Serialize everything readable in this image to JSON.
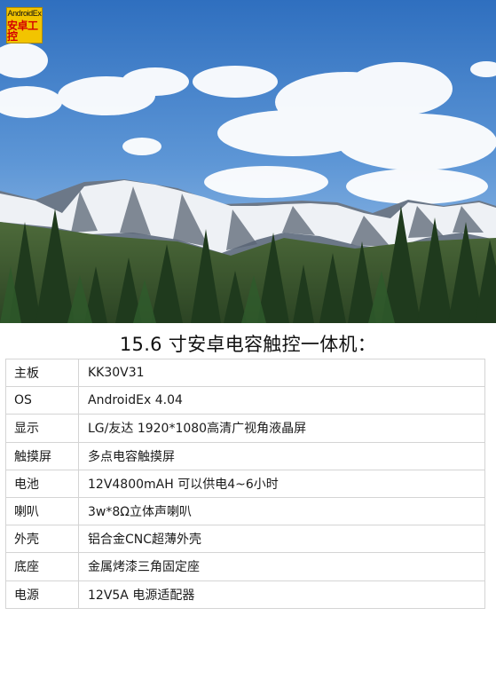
{
  "logo": {
    "line1": "AndroidEx",
    "line2": "安卓工控"
  },
  "title": "15.6 寸安卓电容触控一体机：",
  "specs": [
    {
      "label": "主板",
      "value": "KK30V31"
    },
    {
      "label": "OS",
      "value": "AndroidEx 4.04"
    },
    {
      "label": "显示",
      "value": "LG/友达 1920*1080高清广视角液晶屏"
    },
    {
      "label": "触摸屏",
      "value": "多点电容触摸屏"
    },
    {
      "label": "电池",
      "value": "12V4800mAH 可以供电4~6小时"
    },
    {
      "label": "喇叭",
      "value": "3w*8Ω立体声喇叭"
    },
    {
      "label": "外壳",
      "value": "铝合金CNC超薄外壳"
    },
    {
      "label": "底座",
      "value": "金属烤漆三角固定座"
    },
    {
      "label": "电源",
      "value": "12V5A  电源适配器"
    }
  ]
}
